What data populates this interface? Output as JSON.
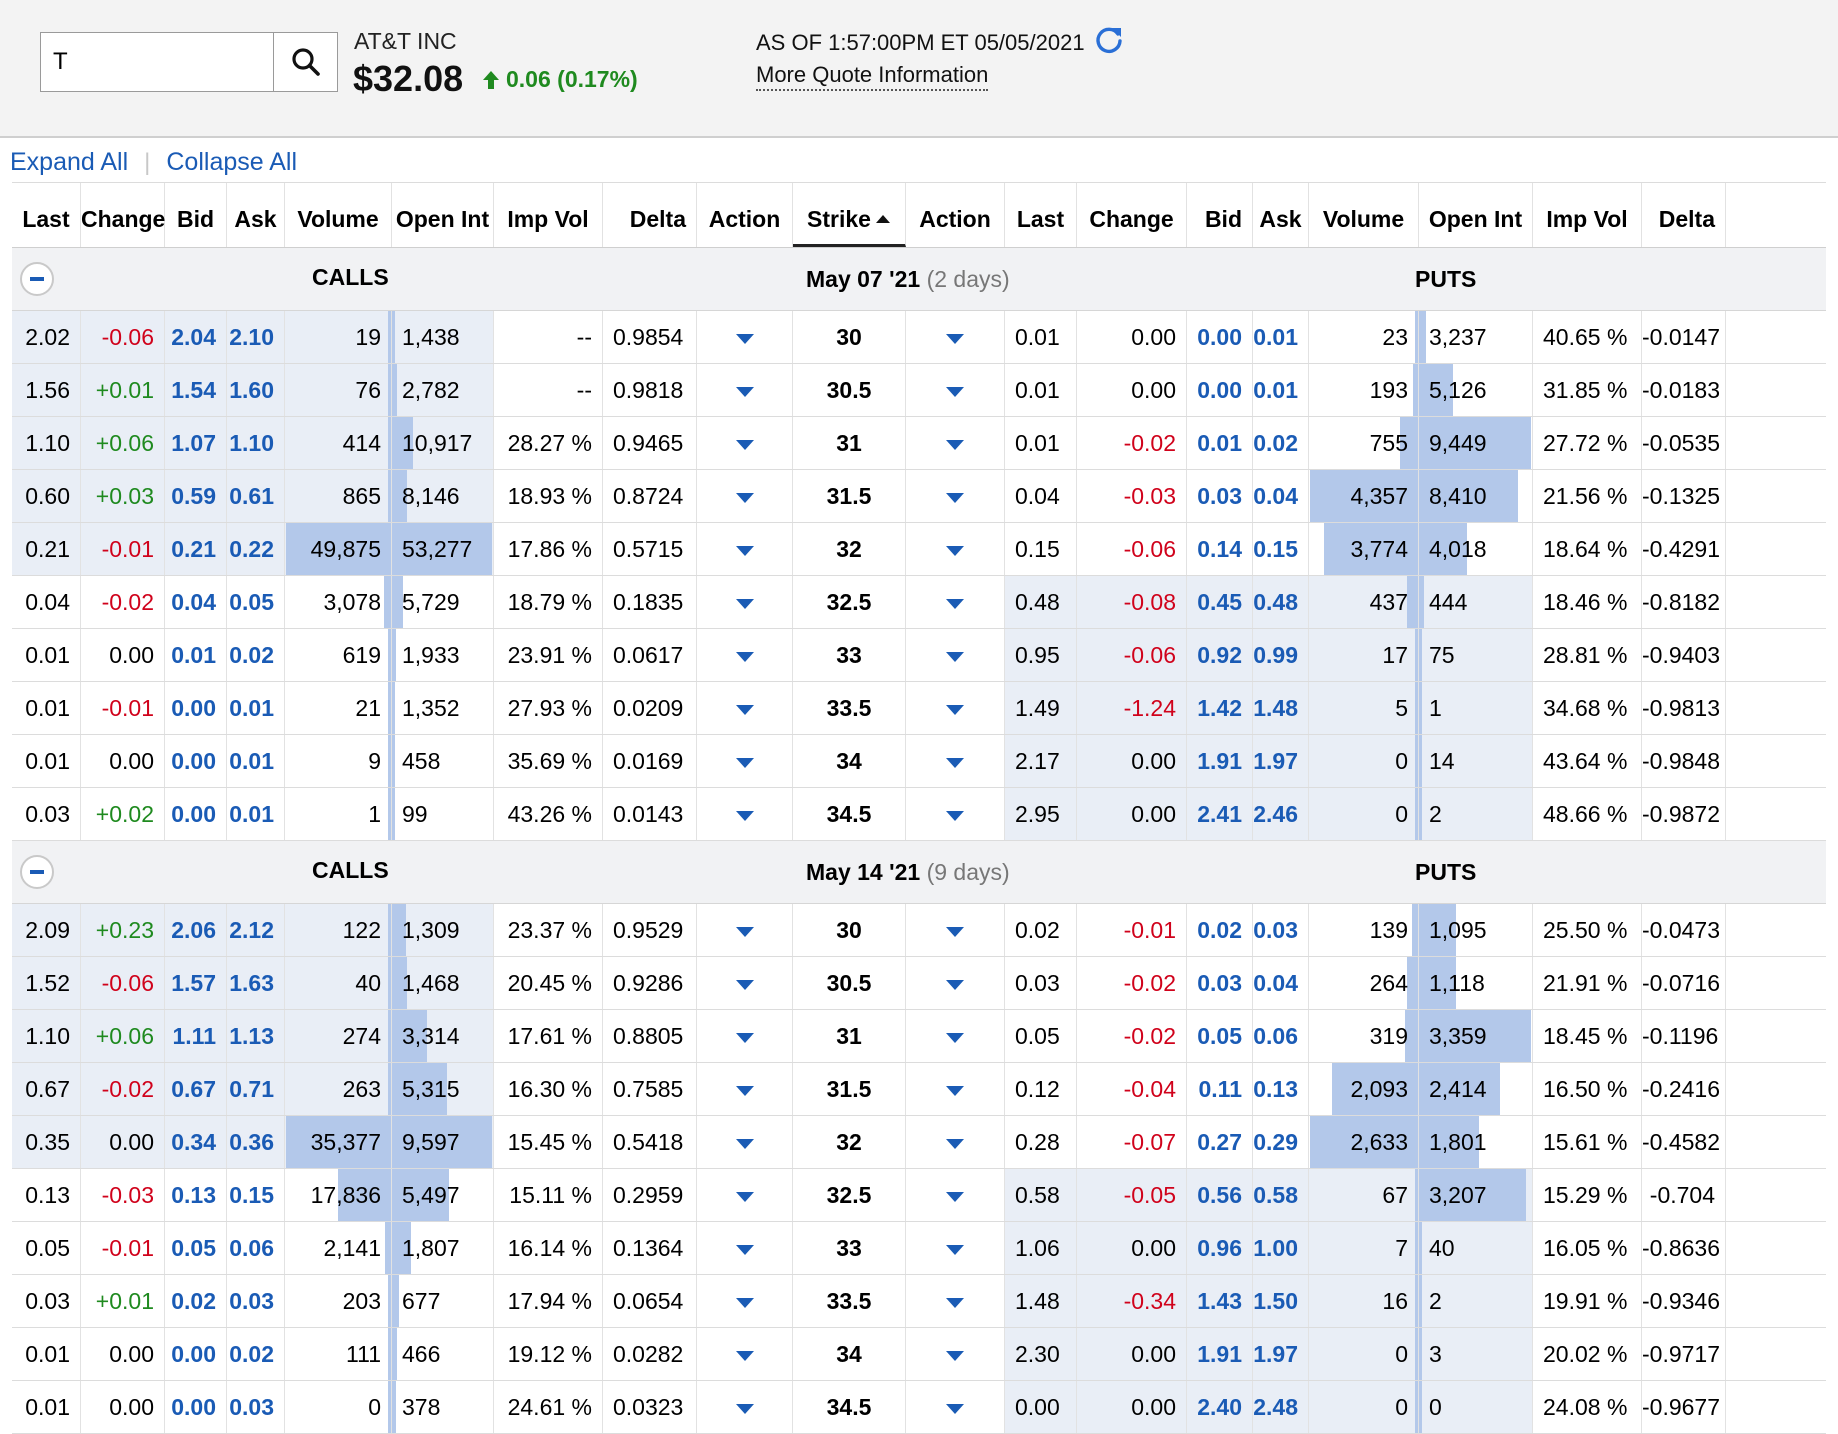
{
  "quote": {
    "symbol": "T",
    "company": "AT&T INC",
    "price": "$32.08",
    "change": "0.06 (0.17%)",
    "as_of": "AS OF 1:57:00PM ET 05/05/2021",
    "more_info": "More Quote Information"
  },
  "controls": {
    "expand_all": "Expand All",
    "separator": "|",
    "collapse_all": "Collapse All"
  },
  "columns": [
    "Last",
    "Change",
    "Bid",
    "Ask",
    "Volume",
    "Open Int",
    "Imp Vol",
    "Delta",
    "Action",
    "Strike",
    "Action",
    "Last",
    "Change",
    "Bid",
    "Ask",
    "Volume",
    "Open Int",
    "Imp Vol",
    "Delta"
  ],
  "colors": {
    "link": "#1a5bb5",
    "up": "#1f8a1f",
    "down": "#d0021b",
    "in_the_money": "#e9eef6",
    "volume_bar": "#b3c8ea"
  },
  "sections": [
    {
      "calls_label": "CALLS",
      "expiry": "May 07 '21",
      "days": "(2 days)",
      "puts_label": "PUTS",
      "rows": [
        {
          "call": {
            "last": "2.02",
            "change": "-0.06",
            "bid": "2.04",
            "ask": "2.10",
            "volume": "19",
            "open_int": "1,438",
            "imp_vol": "--",
            "delta": "0.9854"
          },
          "strike": "30",
          "put": {
            "last": "0.01",
            "change": "0.00",
            "bid": "0.00",
            "ask": "0.01",
            "volume": "23",
            "open_int": "3,237",
            "imp_vol": "40.65 %",
            "delta": "-0.0147"
          },
          "call_itm": true,
          "put_itm": false,
          "cv": 0.0004,
          "co": 0.027,
          "pv": 0.0053,
          "po": 0.061
        },
        {
          "call": {
            "last": "1.56",
            "change": "+0.01",
            "bid": "1.54",
            "ask": "1.60",
            "volume": "76",
            "open_int": "2,782",
            "imp_vol": "--",
            "delta": "0.9818"
          },
          "strike": "30.5",
          "put": {
            "last": "0.01",
            "change": "0.00",
            "bid": "0.00",
            "ask": "0.01",
            "volume": "193",
            "open_int": "5,126",
            "imp_vol": "31.85 %",
            "delta": "-0.0183"
          },
          "call_itm": true,
          "put_itm": false,
          "cv": 0.0015,
          "co": 0.052,
          "pv": 0.044,
          "po": 0.3
        },
        {
          "call": {
            "last": "1.10",
            "change": "+0.06",
            "bid": "1.07",
            "ask": "1.10",
            "volume": "414",
            "open_int": "10,917",
            "imp_vol": "28.27 %",
            "delta": "0.9465"
          },
          "strike": "31",
          "put": {
            "last": "0.01",
            "change": "-0.02",
            "bid": "0.01",
            "ask": "0.02",
            "volume": "755",
            "open_int": "9,449",
            "imp_vol": "27.72 %",
            "delta": "-0.0535"
          },
          "call_itm": true,
          "put_itm": false,
          "cv": 0.0083,
          "co": 0.205,
          "pv": 0.17,
          "po": 1.0
        },
        {
          "call": {
            "last": "0.60",
            "change": "+0.03",
            "bid": "0.59",
            "ask": "0.61",
            "volume": "865",
            "open_int": "8,146",
            "imp_vol": "18.93 %",
            "delta": "0.8724"
          },
          "strike": "31.5",
          "put": {
            "last": "0.04",
            "change": "-0.03",
            "bid": "0.03",
            "ask": "0.04",
            "volume": "4,357",
            "open_int": "8,410",
            "imp_vol": "21.56 %",
            "delta": "-0.1325"
          },
          "call_itm": true,
          "put_itm": false,
          "cv": 0.017,
          "co": 0.153,
          "pv": 1.0,
          "po": 0.88
        },
        {
          "call": {
            "last": "0.21",
            "change": "-0.01",
            "bid": "0.21",
            "ask": "0.22",
            "volume": "49,875",
            "open_int": "53,277",
            "imp_vol": "17.86 %",
            "delta": "0.5715"
          },
          "strike": "32",
          "put": {
            "last": "0.15",
            "change": "-0.06",
            "bid": "0.14",
            "ask": "0.15",
            "volume": "3,774",
            "open_int": "4,018",
            "imp_vol": "18.64 %",
            "delta": "-0.4291"
          },
          "call_itm": true,
          "put_itm": false,
          "cv": 1.0,
          "co": 1.0,
          "pv": 0.87,
          "po": 0.43
        },
        {
          "call": {
            "last": "0.04",
            "change": "-0.02",
            "bid": "0.04",
            "ask": "0.05",
            "volume": "3,078",
            "open_int": "5,729",
            "imp_vol": "18.79 %",
            "delta": "0.1835"
          },
          "strike": "32.5",
          "put": {
            "last": "0.48",
            "change": "-0.08",
            "bid": "0.45",
            "ask": "0.48",
            "volume": "437",
            "open_int": "444",
            "imp_vol": "18.46 %",
            "delta": "-0.8182"
          },
          "call_itm": false,
          "put_itm": true,
          "cv": 0.062,
          "co": 0.108,
          "pv": 0.1,
          "po": 0.047
        },
        {
          "call": {
            "last": "0.01",
            "change": "0.00",
            "bid": "0.01",
            "ask": "0.02",
            "volume": "619",
            "open_int": "1,933",
            "imp_vol": "23.91 %",
            "delta": "0.0617"
          },
          "strike": "33",
          "put": {
            "last": "0.95",
            "change": "-0.06",
            "bid": "0.92",
            "ask": "0.99",
            "volume": "17",
            "open_int": "75",
            "imp_vol": "28.81 %",
            "delta": "-0.9403"
          },
          "call_itm": false,
          "put_itm": true,
          "cv": 0.0124,
          "co": 0.036,
          "pv": 0.004,
          "po": 0.008
        },
        {
          "call": {
            "last": "0.01",
            "change": "-0.01",
            "bid": "0.00",
            "ask": "0.01",
            "volume": "21",
            "open_int": "1,352",
            "imp_vol": "27.93 %",
            "delta": "0.0209"
          },
          "strike": "33.5",
          "put": {
            "last": "1.49",
            "change": "-1.24",
            "bid": "1.42",
            "ask": "1.48",
            "volume": "5",
            "open_int": "1",
            "imp_vol": "34.68 %",
            "delta": "-0.9813"
          },
          "call_itm": false,
          "put_itm": true,
          "cv": 0.0004,
          "co": 0.025,
          "pv": 0.001,
          "po": 0.0001
        },
        {
          "call": {
            "last": "0.01",
            "change": "0.00",
            "bid": "0.00",
            "ask": "0.01",
            "volume": "9",
            "open_int": "458",
            "imp_vol": "35.69 %",
            "delta": "0.0169"
          },
          "strike": "34",
          "put": {
            "last": "2.17",
            "change": "0.00",
            "bid": "1.91",
            "ask": "1.97",
            "volume": "0",
            "open_int": "14",
            "imp_vol": "43.64 %",
            "delta": "-0.9848"
          },
          "call_itm": false,
          "put_itm": true,
          "cv": 0.0002,
          "co": 0.0086,
          "pv": 0,
          "po": 0.0015
        },
        {
          "call": {
            "last": "0.03",
            "change": "+0.02",
            "bid": "0.00",
            "ask": "0.01",
            "volume": "1",
            "open_int": "99",
            "imp_vol": "43.26 %",
            "delta": "0.0143"
          },
          "strike": "34.5",
          "put": {
            "last": "2.95",
            "change": "0.00",
            "bid": "2.41",
            "ask": "2.46",
            "volume": "0",
            "open_int": "2",
            "imp_vol": "48.66 %",
            "delta": "-0.9872"
          },
          "call_itm": false,
          "put_itm": true,
          "cv": 2e-05,
          "co": 0.0019,
          "pv": 0,
          "po": 0.0002
        }
      ]
    },
    {
      "calls_label": "CALLS",
      "expiry": "May 14 '21",
      "days": "(9 days)",
      "puts_label": "PUTS",
      "rows": [
        {
          "call": {
            "last": "2.09",
            "change": "+0.23",
            "bid": "2.06",
            "ask": "2.12",
            "volume": "122",
            "open_int": "1,309",
            "imp_vol": "23.37 %",
            "delta": "0.9529"
          },
          "strike": "30",
          "put": {
            "last": "0.02",
            "change": "-0.01",
            "bid": "0.02",
            "ask": "0.03",
            "volume": "139",
            "open_int": "1,095",
            "imp_vol": "25.50 %",
            "delta": "-0.0473"
          },
          "call_itm": true,
          "put_itm": false,
          "cv": 0.0035,
          "co": 0.14,
          "pv": 0.053,
          "po": 0.33
        },
        {
          "call": {
            "last": "1.52",
            "change": "-0.06",
            "bid": "1.57",
            "ask": "1.63",
            "volume": "40",
            "open_int": "1,468",
            "imp_vol": "20.45 %",
            "delta": "0.9286"
          },
          "strike": "30.5",
          "put": {
            "last": "0.03",
            "change": "-0.02",
            "bid": "0.03",
            "ask": "0.04",
            "volume": "264",
            "open_int": "1,118",
            "imp_vol": "21.91 %",
            "delta": "-0.0716"
          },
          "call_itm": true,
          "put_itm": false,
          "cv": 0.0011,
          "co": 0.15,
          "pv": 0.1,
          "po": 0.33
        },
        {
          "call": {
            "last": "1.10",
            "change": "+0.06",
            "bid": "1.11",
            "ask": "1.13",
            "volume": "274",
            "open_int": "3,314",
            "imp_vol": "17.61 %",
            "delta": "0.8805"
          },
          "strike": "31",
          "put": {
            "last": "0.05",
            "change": "-0.02",
            "bid": "0.05",
            "ask": "0.06",
            "volume": "319",
            "open_int": "3,359",
            "imp_vol": "18.45 %",
            "delta": "-0.1196"
          },
          "call_itm": true,
          "put_itm": false,
          "cv": 0.0077,
          "co": 0.345,
          "pv": 0.12,
          "po": 1.0
        },
        {
          "call": {
            "last": "0.67",
            "change": "-0.02",
            "bid": "0.67",
            "ask": "0.71",
            "volume": "263",
            "open_int": "5,315",
            "imp_vol": "16.30 %",
            "delta": "0.7585"
          },
          "strike": "31.5",
          "put": {
            "last": "0.12",
            "change": "-0.04",
            "bid": "0.11",
            "ask": "0.13",
            "volume": "2,093",
            "open_int": "2,414",
            "imp_vol": "16.50 %",
            "delta": "-0.2416"
          },
          "call_itm": true,
          "put_itm": false,
          "cv": 0.0074,
          "co": 0.55,
          "pv": 0.8,
          "po": 0.72
        },
        {
          "call": {
            "last": "0.35",
            "change": "0.00",
            "bid": "0.34",
            "ask": "0.36",
            "volume": "35,377",
            "open_int": "9,597",
            "imp_vol": "15.45 %",
            "delta": "0.5418"
          },
          "strike": "32",
          "put": {
            "last": "0.28",
            "change": "-0.07",
            "bid": "0.27",
            "ask": "0.29",
            "volume": "2,633",
            "open_int": "1,801",
            "imp_vol": "15.61 %",
            "delta": "-0.4582"
          },
          "call_itm": true,
          "put_itm": false,
          "cv": 1.0,
          "co": 1.0,
          "pv": 1.0,
          "po": 0.54
        },
        {
          "call": {
            "last": "0.13",
            "change": "-0.03",
            "bid": "0.13",
            "ask": "0.15",
            "volume": "17,836",
            "open_int": "5,497",
            "imp_vol": "15.11 %",
            "delta": "0.2959"
          },
          "strike": "32.5",
          "put": {
            "last": "0.58",
            "change": "-0.05",
            "bid": "0.56",
            "ask": "0.58",
            "volume": "67",
            "open_int": "3,207",
            "imp_vol": "15.29 %",
            "delta": "-0.704"
          },
          "call_itm": false,
          "put_itm": true,
          "cv": 0.5,
          "co": 0.57,
          "pv": 0.025,
          "po": 0.955
        },
        {
          "call": {
            "last": "0.05",
            "change": "-0.01",
            "bid": "0.05",
            "ask": "0.06",
            "volume": "2,141",
            "open_int": "1,807",
            "imp_vol": "16.14 %",
            "delta": "0.1364"
          },
          "strike": "33",
          "put": {
            "last": "1.06",
            "change": "0.00",
            "bid": "0.96",
            "ask": "1.00",
            "volume": "7",
            "open_int": "40",
            "imp_vol": "16.05 %",
            "delta": "-0.8636"
          },
          "call_itm": false,
          "put_itm": true,
          "cv": 0.06,
          "co": 0.19,
          "pv": 0.003,
          "po": 0.012
        },
        {
          "call": {
            "last": "0.03",
            "change": "+0.01",
            "bid": "0.02",
            "ask": "0.03",
            "volume": "203",
            "open_int": "677",
            "imp_vol": "17.94 %",
            "delta": "0.0654"
          },
          "strike": "33.5",
          "put": {
            "last": "1.48",
            "change": "-0.34",
            "bid": "1.43",
            "ask": "1.50",
            "volume": "16",
            "open_int": "2",
            "imp_vol": "19.91 %",
            "delta": "-0.9346"
          },
          "call_itm": false,
          "put_itm": true,
          "cv": 0.0057,
          "co": 0.07,
          "pv": 0.006,
          "po": 0.0006
        },
        {
          "call": {
            "last": "0.01",
            "change": "0.00",
            "bid": "0.00",
            "ask": "0.02",
            "volume": "111",
            "open_int": "466",
            "imp_vol": "19.12 %",
            "delta": "0.0282"
          },
          "strike": "34",
          "put": {
            "last": "2.30",
            "change": "0.00",
            "bid": "1.91",
            "ask": "1.97",
            "volume": "0",
            "open_int": "3",
            "imp_vol": "20.02 %",
            "delta": "-0.9717"
          },
          "call_itm": false,
          "put_itm": true,
          "cv": 0.0031,
          "co": 0.049,
          "pv": 0,
          "po": 0.0009
        },
        {
          "call": {
            "last": "0.01",
            "change": "0.00",
            "bid": "0.00",
            "ask": "0.03",
            "volume": "0",
            "open_int": "378",
            "imp_vol": "24.61 %",
            "delta": "0.0323"
          },
          "strike": "34.5",
          "put": {
            "last": "0.00",
            "change": "0.00",
            "bid": "2.40",
            "ask": "2.48",
            "volume": "0",
            "open_int": "0",
            "imp_vol": "24.08 %",
            "delta": "-0.9677"
          },
          "call_itm": false,
          "put_itm": true,
          "cv": 0,
          "co": 0.039,
          "pv": 0,
          "po": 0
        }
      ]
    }
  ]
}
